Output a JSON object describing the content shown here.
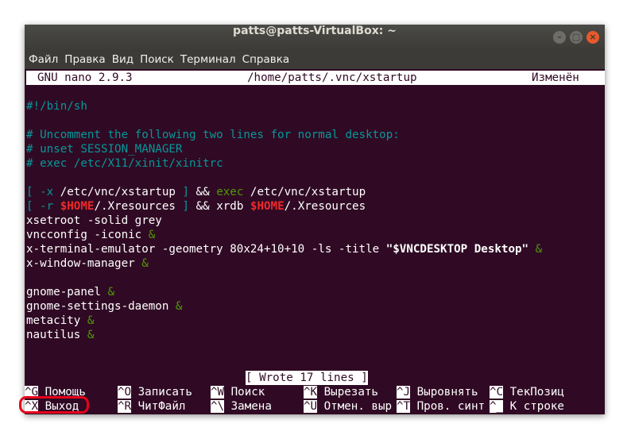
{
  "window": {
    "title": "patts@patts-VirtualBox: ~",
    "controls": {
      "minimize": "–",
      "maximize": "□",
      "close": "×"
    }
  },
  "menubar": [
    "Файл",
    "Правка",
    "Вид",
    "Поиск",
    "Терминал",
    "Справка"
  ],
  "nano": {
    "version": "GNU nano 2.9.3",
    "file_path": "/home/patts/.vnc/xstartup",
    "modified": "Изменён"
  },
  "editor": {
    "shebang": "#!/bin/sh",
    "comment1": "# Uncomment the following two lines for normal desktop:",
    "comment2": "# unset SESSION_MANAGER",
    "comment3": "# exec /etc/X11/xinit/xinitrc",
    "l5": {
      "b1": "[ -x",
      "t1": " /etc/vnc/xstartup ",
      "b2": "]",
      "t2": " && ",
      "kw": "exec",
      "t3": " /etc/vnc/xstartup"
    },
    "l6": {
      "b1": "[ -r",
      "t1": " ",
      "v1": "$HOME",
      "t2": "/.Xresources ",
      "b2": "]",
      "t3": " && xrdb ",
      "v2": "$HOME",
      "t4": "/.Xresources"
    },
    "l7": "xsetroot -solid grey",
    "l8": {
      "t": "vncconfig -iconic ",
      "amp": "&"
    },
    "l9": {
      "t": "x-terminal-emulator -geometry 80x24+10+10 -ls -title ",
      "str": "\"$VNCDESKTOP Desktop\"",
      "amp": " &"
    },
    "l10": {
      "t": "x-window-manager ",
      "amp": "&"
    },
    "l11": {
      "t": "gnome-panel ",
      "amp": "&"
    },
    "l12": {
      "t": "gnome-settings-daemon ",
      "amp": "&"
    },
    "l13": {
      "t": "metacity ",
      "amp": "&"
    },
    "l14": {
      "t": "nautilus ",
      "amp": "&"
    }
  },
  "status_message": "[ Wrote 17 lines ]",
  "shortcuts_row1": [
    {
      "key": "^G",
      "label": " Помощь"
    },
    {
      "key": "^O",
      "label": " Записать"
    },
    {
      "key": "^W",
      "label": " Поиск"
    },
    {
      "key": "^K",
      "label": " Вырезать"
    },
    {
      "key": "^J",
      "label": " Выровнять"
    },
    {
      "key": "^C",
      "label": " ТекПозиц"
    }
  ],
  "shortcuts_row2": [
    {
      "key": "^X",
      "label": " Выход"
    },
    {
      "key": "^R",
      "label": " ЧитФайл"
    },
    {
      "key": "^\\",
      "label": " Замена"
    },
    {
      "key": "^U",
      "label": " Отмен. выр"
    },
    {
      "key": "^T",
      "label": " Пров. синт"
    },
    {
      "key": "^_",
      "label": " К строке"
    }
  ],
  "colors": {
    "terminal_bg": "#300a24",
    "comment": "#06989a",
    "keyword": "#4e9a06",
    "variable": "#ef2929",
    "highlight": "#e8001c"
  }
}
